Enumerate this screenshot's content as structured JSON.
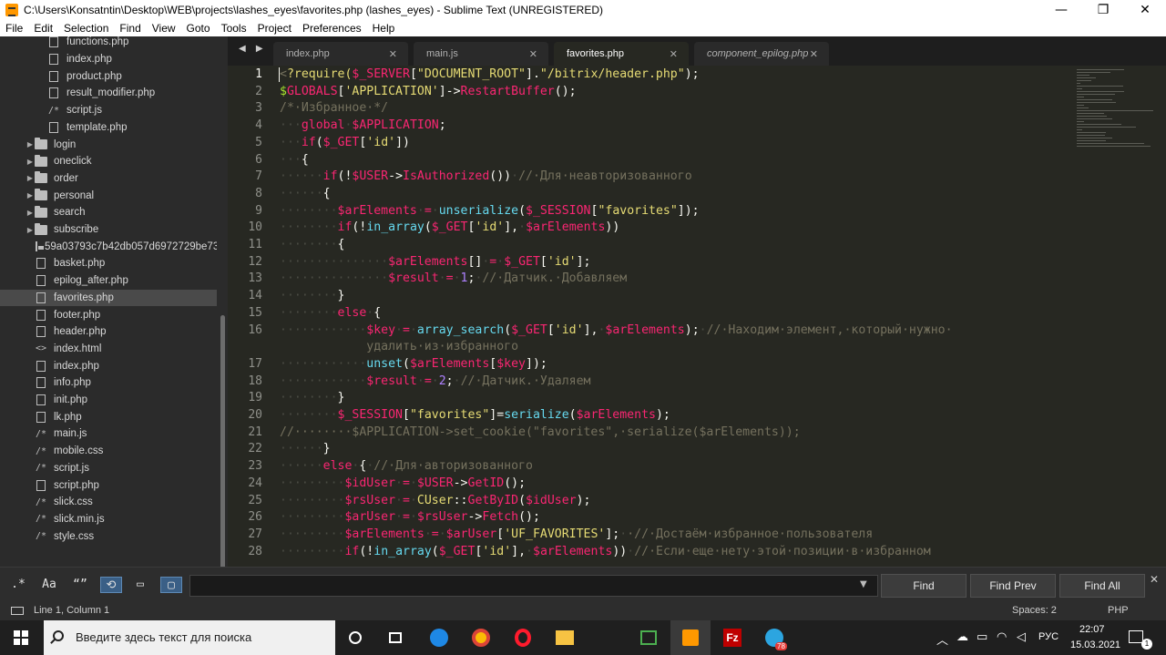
{
  "window": {
    "title": "C:\\Users\\Konsatntin\\Desktop\\WEB\\projects\\lashes_eyes\\favorites.php (lashes_eyes) - Sublime Text (UNREGISTERED)",
    "minimize": "—",
    "maximize": "❐",
    "close": "✕"
  },
  "menu": [
    "File",
    "Edit",
    "Selection",
    "Find",
    "View",
    "Goto",
    "Tools",
    "Project",
    "Preferences",
    "Help"
  ],
  "sidebar": {
    "items": [
      {
        "label": "functions.php",
        "kind": "file",
        "indent": 52
      },
      {
        "label": "index.php",
        "kind": "file",
        "indent": 52
      },
      {
        "label": "product.php",
        "kind": "file",
        "indent": 52
      },
      {
        "label": "result_modifier.php",
        "kind": "file",
        "indent": 52
      },
      {
        "label": "script.js",
        "kind": "code",
        "glyph": "/*",
        "indent": 52
      },
      {
        "label": "template.php",
        "kind": "file",
        "indent": 52
      },
      {
        "label": "login",
        "kind": "folder",
        "indent": 28
      },
      {
        "label": "oneclick",
        "kind": "folder",
        "indent": 28
      },
      {
        "label": "order",
        "kind": "folder",
        "indent": 28
      },
      {
        "label": "personal",
        "kind": "folder",
        "indent": 28
      },
      {
        "label": "search",
        "kind": "folder",
        "indent": 28
      },
      {
        "label": "subscribe",
        "kind": "folder",
        "indent": 28
      },
      {
        "label": "59a03793c7b42db057d6972729be73",
        "kind": "image",
        "indent": 38
      },
      {
        "label": "basket.php",
        "kind": "file",
        "indent": 38
      },
      {
        "label": "epilog_after.php",
        "kind": "file",
        "indent": 38
      },
      {
        "label": "favorites.php",
        "kind": "file",
        "indent": 38,
        "selected": true
      },
      {
        "label": "footer.php",
        "kind": "file",
        "indent": 38
      },
      {
        "label": "header.php",
        "kind": "file",
        "indent": 38
      },
      {
        "label": "index.html",
        "kind": "code",
        "glyph": "<>",
        "indent": 38
      },
      {
        "label": "index.php",
        "kind": "file",
        "indent": 38
      },
      {
        "label": "info.php",
        "kind": "file",
        "indent": 38
      },
      {
        "label": "init.php",
        "kind": "file",
        "indent": 38
      },
      {
        "label": "lk.php",
        "kind": "file",
        "indent": 38
      },
      {
        "label": "main.js",
        "kind": "code",
        "glyph": "/*",
        "indent": 38
      },
      {
        "label": "mobile.css",
        "kind": "code",
        "glyph": "/*",
        "indent": 38
      },
      {
        "label": "script.js",
        "kind": "code",
        "glyph": "/*",
        "indent": 38
      },
      {
        "label": "script.php",
        "kind": "file",
        "indent": 38
      },
      {
        "label": "slick.css",
        "kind": "code",
        "glyph": "/*",
        "indent": 38
      },
      {
        "label": "slick.min.js",
        "kind": "code",
        "glyph": "/*",
        "indent": 38
      },
      {
        "label": "style.css",
        "kind": "code",
        "glyph": "/*",
        "indent": 38
      }
    ]
  },
  "tabs": {
    "nav": "◀ ▶",
    "items": [
      {
        "label": "index.php",
        "active": false,
        "italic": false
      },
      {
        "label": "main.js",
        "active": false,
        "italic": false
      },
      {
        "label": "favorites.php",
        "active": true,
        "italic": false
      },
      {
        "label": "component_epilog.php",
        "active": false,
        "italic": true
      }
    ],
    "close_glyph": "✕"
  },
  "editor": {
    "lines": [
      {
        "n": "1",
        "tokens": [
          [
            "cm",
            "<"
          ],
          [
            "tk-str",
            "?require("
          ],
          [
            "tk-var",
            "$_SERVER"
          ],
          [
            "tk-op",
            "["
          ],
          [
            "tk-str",
            "\"DOCUMENT_ROOT\""
          ],
          [
            "tk-op",
            "]."
          ],
          [
            "tk-str",
            "\"/bitrix/header.php\""
          ],
          [
            "tk-op",
            ");"
          ]
        ]
      },
      {
        "n": "2",
        "tokens": [
          [
            "tk-cls",
            "$"
          ],
          [
            "tk-var",
            "GLOBALS"
          ],
          [
            "tk-op",
            "["
          ],
          [
            "tk-str",
            "'APPLICATION'"
          ],
          [
            "tk-op",
            "]->"
          ],
          [
            "tk-var",
            "RestartBuffer"
          ],
          [
            "tk-op",
            "();"
          ]
        ]
      },
      {
        "n": "3",
        "tokens": [
          [
            "tk-cm",
            "/*·Избранное·*/"
          ]
        ]
      },
      {
        "n": "4",
        "tokens": [
          [
            "tk-dot",
            "···"
          ],
          [
            "tk-kw",
            "global"
          ],
          [
            "tk-dot",
            "·"
          ],
          [
            "tk-var",
            "$APPLICATION"
          ],
          [
            "tk-op",
            ";"
          ]
        ]
      },
      {
        "n": "5",
        "tokens": [
          [
            "tk-dot",
            "···"
          ],
          [
            "tk-kw",
            "if"
          ],
          [
            "tk-op",
            "("
          ],
          [
            "tk-var",
            "$_GET"
          ],
          [
            "tk-op",
            "["
          ],
          [
            "tk-str",
            "'id'"
          ],
          [
            "tk-op",
            "])"
          ]
        ]
      },
      {
        "n": "6",
        "tokens": [
          [
            "tk-dot",
            "···"
          ],
          [
            "tk-op",
            "{"
          ]
        ]
      },
      {
        "n": "7",
        "tokens": [
          [
            "tk-dot",
            "······"
          ],
          [
            "tk-kw",
            "if"
          ],
          [
            "tk-op",
            "(!"
          ],
          [
            "tk-var",
            "$USER"
          ],
          [
            "tk-op",
            "->"
          ],
          [
            "tk-var",
            "IsAuthorized"
          ],
          [
            "tk-op",
            "())"
          ],
          [
            "tk-dot",
            "·"
          ],
          [
            "tk-cm",
            "//·Для·неавторизованного"
          ]
        ]
      },
      {
        "n": "8",
        "tokens": [
          [
            "tk-dot",
            "······"
          ],
          [
            "tk-op",
            "{"
          ]
        ]
      },
      {
        "n": "9",
        "tokens": [
          [
            "tk-dot",
            "········"
          ],
          [
            "tk-var",
            "$arElements"
          ],
          [
            "tk-dot",
            "·"
          ],
          [
            "tk-kw",
            "="
          ],
          [
            "tk-dot",
            "·"
          ],
          [
            "tk-fn",
            "unserialize"
          ],
          [
            "tk-op",
            "("
          ],
          [
            "tk-var",
            "$_SESSION"
          ],
          [
            "tk-op",
            "["
          ],
          [
            "tk-str",
            "\"favorites\""
          ],
          [
            "tk-op",
            "]);"
          ]
        ]
      },
      {
        "n": "10",
        "tokens": [
          [
            "tk-dot",
            "········"
          ],
          [
            "tk-kw",
            "if"
          ],
          [
            "tk-op",
            "(!"
          ],
          [
            "tk-fn",
            "in_array"
          ],
          [
            "tk-op",
            "("
          ],
          [
            "tk-var",
            "$_GET"
          ],
          [
            "tk-op",
            "["
          ],
          [
            "tk-str",
            "'id'"
          ],
          [
            "tk-op",
            "],"
          ],
          [
            "tk-dot",
            "·"
          ],
          [
            "tk-var",
            "$arElements"
          ],
          [
            "tk-op",
            "))"
          ]
        ]
      },
      {
        "n": "11",
        "tokens": [
          [
            "tk-dot",
            "········"
          ],
          [
            "tk-op",
            "{"
          ]
        ]
      },
      {
        "n": "12",
        "tokens": [
          [
            "tk-dot",
            "···············"
          ],
          [
            "tk-var",
            "$arElements"
          ],
          [
            "tk-op",
            "[]"
          ],
          [
            "tk-dot",
            "·"
          ],
          [
            "tk-kw",
            "="
          ],
          [
            "tk-dot",
            "·"
          ],
          [
            "tk-var",
            "$_GET"
          ],
          [
            "tk-op",
            "["
          ],
          [
            "tk-str",
            "'id'"
          ],
          [
            "tk-op",
            "];"
          ]
        ]
      },
      {
        "n": "13",
        "tokens": [
          [
            "tk-dot",
            "···············"
          ],
          [
            "tk-var",
            "$result"
          ],
          [
            "tk-dot",
            "·"
          ],
          [
            "tk-kw",
            "="
          ],
          [
            "tk-dot",
            "·"
          ],
          [
            "tk-num",
            "1"
          ],
          [
            "tk-op",
            ";"
          ],
          [
            "tk-dot",
            "·"
          ],
          [
            "tk-cm",
            "//·Датчик.·Добавляем"
          ]
        ]
      },
      {
        "n": "14",
        "tokens": [
          [
            "tk-dot",
            "········"
          ],
          [
            "tk-op",
            "}"
          ]
        ]
      },
      {
        "n": "15",
        "tokens": [
          [
            "tk-dot",
            "········"
          ],
          [
            "tk-kw",
            "else"
          ],
          [
            "tk-dot",
            "·"
          ],
          [
            "tk-op",
            "{"
          ]
        ]
      },
      {
        "n": "16",
        "tokens": [
          [
            "tk-dot",
            "············"
          ],
          [
            "tk-var",
            "$key"
          ],
          [
            "tk-dot",
            "·"
          ],
          [
            "tk-kw",
            "="
          ],
          [
            "tk-dot",
            "·"
          ],
          [
            "tk-fn",
            "array_search"
          ],
          [
            "tk-op",
            "("
          ],
          [
            "tk-var",
            "$_GET"
          ],
          [
            "tk-op",
            "["
          ],
          [
            "tk-str",
            "'id'"
          ],
          [
            "tk-op",
            "],"
          ],
          [
            "tk-dot",
            "·"
          ],
          [
            "tk-var",
            "$arElements"
          ],
          [
            "tk-op",
            ");"
          ],
          [
            "tk-dot",
            "·"
          ],
          [
            "tk-cm",
            "//·Находим·элемент,·который·нужно·"
          ]
        ]
      },
      {
        "n": "",
        "tokens": [
          [
            "tk-op",
            "            "
          ],
          [
            "tk-cm",
            "удалить·из·избранного"
          ]
        ]
      },
      {
        "n": "17",
        "tokens": [
          [
            "tk-dot",
            "············"
          ],
          [
            "tk-fn",
            "unset"
          ],
          [
            "tk-op",
            "("
          ],
          [
            "tk-var",
            "$arElements"
          ],
          [
            "tk-op",
            "["
          ],
          [
            "tk-var",
            "$key"
          ],
          [
            "tk-op",
            "]);"
          ]
        ]
      },
      {
        "n": "18",
        "tokens": [
          [
            "tk-dot",
            "············"
          ],
          [
            "tk-var",
            "$result"
          ],
          [
            "tk-dot",
            "·"
          ],
          [
            "tk-kw",
            "="
          ],
          [
            "tk-dot",
            "·"
          ],
          [
            "tk-num",
            "2"
          ],
          [
            "tk-op",
            ";"
          ],
          [
            "tk-dot",
            "·"
          ],
          [
            "tk-cm",
            "//·Датчик.·Удаляем"
          ]
        ]
      },
      {
        "n": "19",
        "tokens": [
          [
            "tk-dot",
            "········"
          ],
          [
            "tk-op",
            "}"
          ]
        ]
      },
      {
        "n": "20",
        "tokens": [
          [
            "tk-dot",
            "········"
          ],
          [
            "tk-var",
            "$_SESSION"
          ],
          [
            "tk-op",
            "["
          ],
          [
            "tk-str",
            "\"favorites\""
          ],
          [
            "tk-op",
            "]="
          ],
          [
            "tk-fn",
            "serialize"
          ],
          [
            "tk-op",
            "("
          ],
          [
            "tk-var",
            "$arElements"
          ],
          [
            "tk-op",
            ");"
          ]
        ]
      },
      {
        "n": "21",
        "tokens": [
          [
            "tk-cm",
            "//········$APPLICATION->set_cookie(\"favorites\",·serialize($arElements));"
          ]
        ]
      },
      {
        "n": "22",
        "tokens": [
          [
            "tk-dot",
            "······"
          ],
          [
            "tk-op",
            "}"
          ]
        ]
      },
      {
        "n": "23",
        "tokens": [
          [
            "tk-dot",
            "······"
          ],
          [
            "tk-kw",
            "else"
          ],
          [
            "tk-dot",
            "·"
          ],
          [
            "tk-op",
            "{"
          ],
          [
            "tk-dot",
            "·"
          ],
          [
            "tk-cm",
            "//·Для·авторизованного"
          ]
        ]
      },
      {
        "n": "24",
        "tokens": [
          [
            "tk-dot",
            "·········"
          ],
          [
            "tk-var",
            "$idUser"
          ],
          [
            "tk-dot",
            "·"
          ],
          [
            "tk-kw",
            "="
          ],
          [
            "tk-dot",
            "·"
          ],
          [
            "tk-var",
            "$USER"
          ],
          [
            "tk-op",
            "->"
          ],
          [
            "tk-var",
            "GetID"
          ],
          [
            "tk-op",
            "();"
          ]
        ]
      },
      {
        "n": "25",
        "tokens": [
          [
            "tk-dot",
            "·········"
          ],
          [
            "tk-var",
            "$rsUser"
          ],
          [
            "tk-dot",
            "·"
          ],
          [
            "tk-kw",
            "="
          ],
          [
            "tk-dot",
            "·"
          ],
          [
            "tk-str",
            "CUser"
          ],
          [
            "tk-op",
            "::"
          ],
          [
            "tk-var",
            "GetByID"
          ],
          [
            "tk-op",
            "("
          ],
          [
            "tk-var",
            "$idUser"
          ],
          [
            "tk-op",
            ");"
          ]
        ]
      },
      {
        "n": "26",
        "tokens": [
          [
            "tk-dot",
            "·········"
          ],
          [
            "tk-var",
            "$arUser"
          ],
          [
            "tk-dot",
            "·"
          ],
          [
            "tk-kw",
            "="
          ],
          [
            "tk-dot",
            "·"
          ],
          [
            "tk-var",
            "$rsUser"
          ],
          [
            "tk-op",
            "->"
          ],
          [
            "tk-var",
            "Fetch"
          ],
          [
            "tk-op",
            "();"
          ]
        ]
      },
      {
        "n": "27",
        "tokens": [
          [
            "tk-dot",
            "·········"
          ],
          [
            "tk-var",
            "$arElements"
          ],
          [
            "tk-dot",
            "·"
          ],
          [
            "tk-kw",
            "="
          ],
          [
            "tk-dot",
            "·"
          ],
          [
            "tk-var",
            "$arUser"
          ],
          [
            "tk-op",
            "["
          ],
          [
            "tk-str",
            "'UF_FAVORITES'"
          ],
          [
            "tk-op",
            "];"
          ],
          [
            "tk-dot",
            "·"
          ],
          [
            "tk-cm",
            "·//·Достаём·избранное·пользователя"
          ]
        ]
      },
      {
        "n": "28",
        "tokens": [
          [
            "tk-dot",
            "·········"
          ],
          [
            "tk-kw",
            "if"
          ],
          [
            "tk-op",
            "(!"
          ],
          [
            "tk-fn",
            "in_array"
          ],
          [
            "tk-op",
            "("
          ],
          [
            "tk-var",
            "$_GET"
          ],
          [
            "tk-op",
            "["
          ],
          [
            "tk-str",
            "'id'"
          ],
          [
            "tk-op",
            "],"
          ],
          [
            "tk-dot",
            "·"
          ],
          [
            "tk-var",
            "$arElements"
          ],
          [
            "tk-op",
            "))"
          ],
          [
            "tk-dot",
            "·"
          ],
          [
            "tk-cm",
            "//·Если·еще·нету·этой·позиции·в·избранном"
          ]
        ]
      }
    ]
  },
  "find": {
    "regex_toggle": ".*",
    "case_toggle": "Aa",
    "word_toggle": "“”",
    "find_label": "Find",
    "find_prev_label": "Find Prev",
    "find_all_label": "Find All",
    "dropdown": "▼",
    "close": "✕"
  },
  "status": {
    "position": "Line 1, Column 1",
    "spaces": "Spaces: 2",
    "syntax": "PHP"
  },
  "taskbar": {
    "search_placeholder": "Введите здесь текст для поиска",
    "lang": "РУС",
    "time": "22:07",
    "date": "15.03.2021",
    "notif_count": "1",
    "telegram_badge": "78"
  }
}
